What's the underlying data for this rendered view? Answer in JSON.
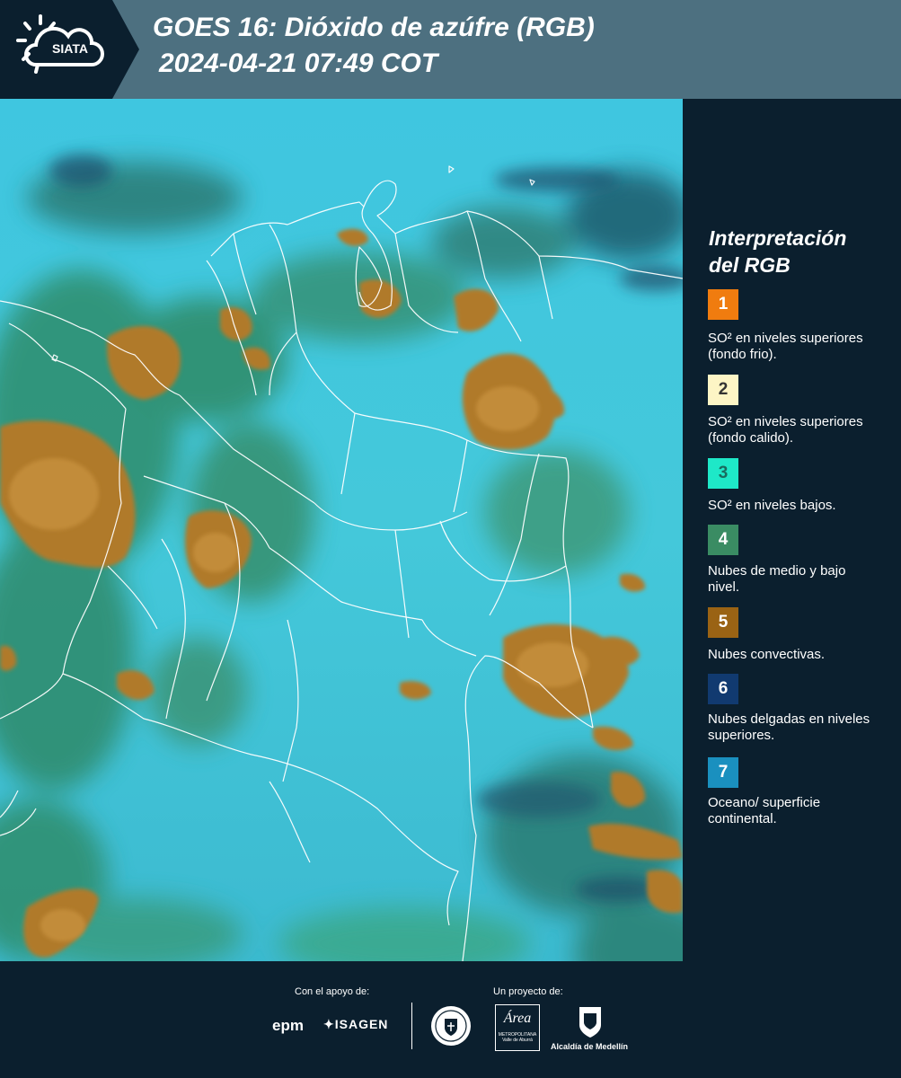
{
  "header": {
    "title_line1": "GOES 16: Dióxido de azúfre (RGB)",
    "title_line2": " 2024-04-21 07:49 COT",
    "logo_text": "SIATA"
  },
  "legend": {
    "title_line1": "Interpretación",
    "title_line2": "del RGB",
    "items": [
      {
        "num": "1",
        "color": "#f07c0f",
        "num_color": "#ffffff",
        "text": "SO² en niveles superiores (fondo frio)."
      },
      {
        "num": "2",
        "color": "#fdf5c5",
        "num_color": "#333333",
        "text": "SO² en niveles superiores (fondo calido)."
      },
      {
        "num": "3",
        "color": "#1ee8c8",
        "num_color": "#1a6a5e",
        "text": "SO² en niveles bajos."
      },
      {
        "num": "4",
        "color": "#3a8c63",
        "num_color": "#ffffff",
        "text": "Nubes de medio y bajo nivel."
      },
      {
        "num": "5",
        "color": "#9a6314",
        "num_color": "#ffffff",
        "text": "Nubes convectivas."
      },
      {
        "num": "6",
        "color": "#113a70",
        "num_color": "#ffffff",
        "text": "Nubes delgadas en niveles superiores."
      },
      {
        "num": "7",
        "color": "#1a90bf",
        "num_color": "#ffffff",
        "text": "Oceano/ superficie continental."
      }
    ]
  },
  "footer": {
    "support_label": "Con el apoyo de:",
    "project_label": "Un proyecto de:",
    "epm_logo": "epm",
    "isagen_logo": "ISAGEN",
    "area_logo": "Área",
    "area_subtitle": "METROPOLITANA Valle de Aburrá",
    "alcaldia_logo": "Alcaldía de Medellín"
  },
  "colors": {
    "header_bg": "#4d7080",
    "logo_bg": "#0b1f2e",
    "panel_bg": "#0b1f2e",
    "map_base": "#3ec2d8",
    "map_land_green": "#2f8c6a",
    "map_convective": "#b07a2a"
  }
}
